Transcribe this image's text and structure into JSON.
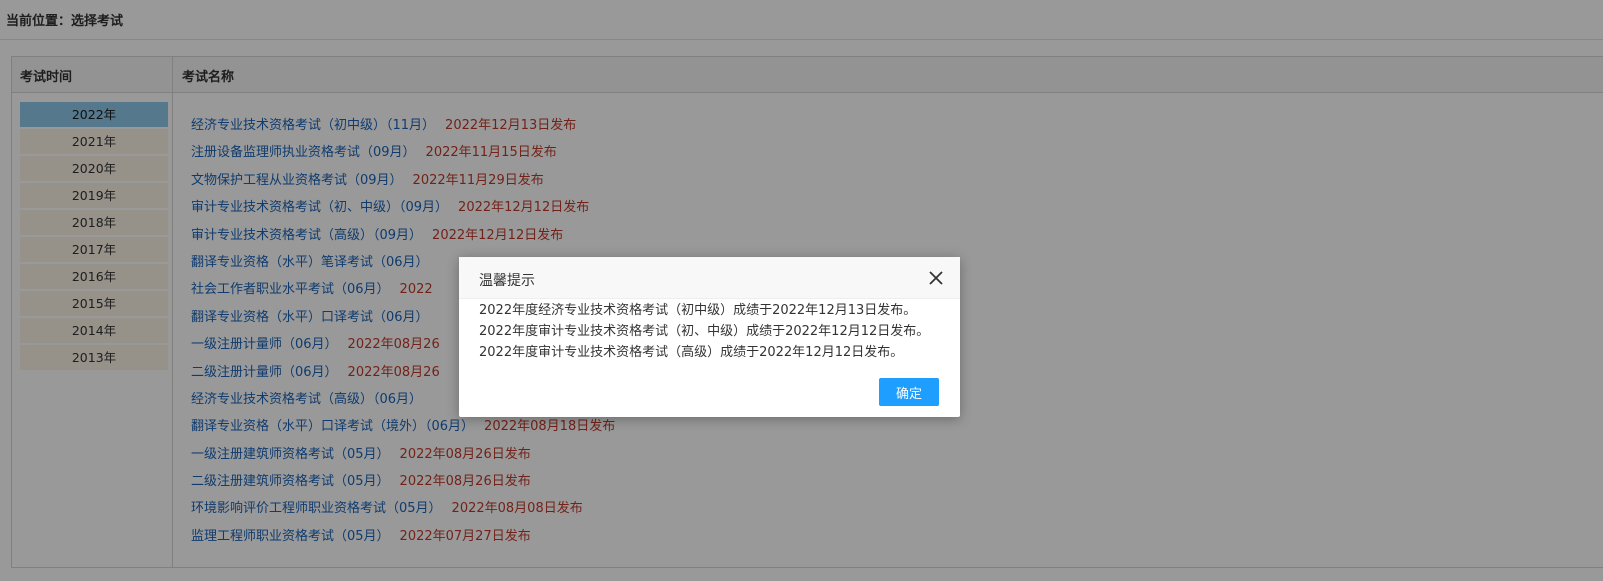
{
  "breadcrumb": "当前位置：选择考试",
  "table": {
    "col_time": "考试时间",
    "col_name": "考试名称"
  },
  "years": [
    {
      "label": "2022年",
      "active": true
    },
    {
      "label": "2021年"
    },
    {
      "label": "2020年"
    },
    {
      "label": "2019年"
    },
    {
      "label": "2018年"
    },
    {
      "label": "2017年"
    },
    {
      "label": "2016年"
    },
    {
      "label": "2015年"
    },
    {
      "label": "2014年"
    },
    {
      "label": "2013年"
    }
  ],
  "exams": [
    {
      "name": "经济专业技术资格考试（初中级）（11月）",
      "date": "2022年12月13日发布"
    },
    {
      "name": "注册设备监理师执业资格考试（09月）",
      "date": "2022年11月15日发布"
    },
    {
      "name": "文物保护工程从业资格考试（09月）",
      "date": "2022年11月29日发布"
    },
    {
      "name": "审计专业技术资格考试（初、中级）（09月）",
      "date": "2022年12月12日发布"
    },
    {
      "name": "审计专业技术资格考试（高级）（09月）",
      "date": "2022年12月12日发布"
    },
    {
      "name": "翻译专业资格（水平）笔译考试（06月）",
      "date": ""
    },
    {
      "name": "社会工作者职业水平考试（06月）",
      "date": "2022"
    },
    {
      "name": "翻译专业资格（水平）口译考试（06月）",
      "date": ""
    },
    {
      "name": "一级注册计量师（06月）",
      "date": "2022年08月26"
    },
    {
      "name": "二级注册计量师（06月）",
      "date": "2022年08月26"
    },
    {
      "name": "经济专业技术资格考试（高级）（06月）",
      "date": ""
    },
    {
      "name": "翻译专业资格（水平）口译考试（境外）（06月）",
      "date": "2022年08月18日发布"
    },
    {
      "name": "一级注册建筑师资格考试（05月）",
      "date": "2022年08月26日发布"
    },
    {
      "name": "二级注册建筑师资格考试（05月）",
      "date": "2022年08月26日发布"
    },
    {
      "name": "环境影响评价工程师职业资格考试（05月）",
      "date": "2022年08月08日发布"
    },
    {
      "name": "监理工程师职业资格考试（05月）",
      "date": "2022年07月27日发布"
    }
  ],
  "modal": {
    "title": "温馨提示",
    "close_icon": "close-icon",
    "lines": [
      "2022年度经济专业技术资格考试（初中级）成绩于2022年12月13日发布。",
      "2022年度审计专业技术资格考试（初、中级）成绩于2022年12月12日发布。",
      "2022年度审计专业技术资格考试（高级）成绩于2022年12月12日发布。"
    ],
    "ok_label": "确定"
  },
  "colors": {
    "link": "#1a63b8",
    "date": "#c0392b",
    "year_active": "#8fc8ec",
    "year_bg": "#fbf3e6",
    "button": "#1e9fff"
  }
}
